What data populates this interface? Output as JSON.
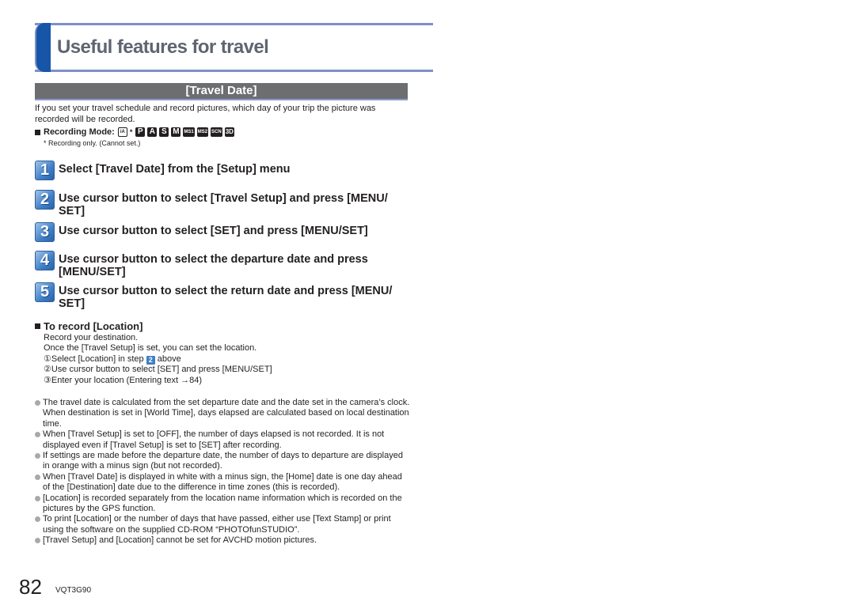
{
  "header": {
    "title": "Useful features for travel"
  },
  "section": {
    "title": "[Travel Date]"
  },
  "intro": "If you set your travel schedule and record pictures, which day of your trip the picture was recorded will be recorded.",
  "recording_mode": {
    "label": "Recording Mode:",
    "icons": [
      {
        "name": "intelligent-auto-mode-icon",
        "glyph": "iA",
        "starred": true
      },
      {
        "name": "program-mode-icon",
        "glyph": "P"
      },
      {
        "name": "aperture-priority-mode-icon",
        "glyph": "A"
      },
      {
        "name": "shutter-priority-mode-icon",
        "glyph": "S"
      },
      {
        "name": "manual-mode-icon",
        "glyph": "M"
      },
      {
        "name": "custom-1-mode-icon",
        "glyph": "MS1"
      },
      {
        "name": "custom-2-mode-icon",
        "glyph": "MS2"
      },
      {
        "name": "scene-mode-icon",
        "glyph": "SCN"
      },
      {
        "name": "3d-mode-icon",
        "glyph": "3D"
      }
    ],
    "star": "*",
    "note": "* Recording only. (Cannot set.)"
  },
  "steps": [
    {
      "number": "1",
      "text": "Select [Travel Date] from the [Setup] menu"
    },
    {
      "number": "2",
      "text": "Use cursor button to select [Travel Setup] and press [MENU/ SET]"
    },
    {
      "number": "3",
      "text": "Use cursor button to select [SET] and press [MENU/SET]"
    },
    {
      "number": "4",
      "text": "Use cursor button to select the departure date and press [MENU/SET]"
    },
    {
      "number": "5",
      "text": "Use cursor button to select the return date and press [MENU/ SET]"
    }
  ],
  "location": {
    "title": "To record [Location]",
    "line1": "Record your destination.",
    "line2": "Once the [Travel Setup] is set, you can set the location.",
    "sub1_prefix": "①Select [Location] in step",
    "sub1_step": "2",
    "sub1_suffix": "above",
    "sub2": "②Use cursor button to select [SET] and press [MENU/SET]",
    "sub3": "③Enter your location (Entering text →84)"
  },
  "notes": [
    "The travel date is calculated from the set departure date and the date set in the camera’s clock. When destination is set in [World Time], days elapsed are calculated based on local destination time.",
    "When [Travel Setup] is set to [OFF], the number of days elapsed is not recorded. It is not displayed even if [Travel Setup] is set to [SET] after recording.",
    "If settings are made before the departure date, the number of days to departure are displayed in orange with a minus sign (but not recorded).",
    "When [Travel Date] is displayed in white with a minus sign, the [Home] date is one day ahead of the [Destination] date due to the difference in time zones (this is recorded).",
    "[Location] is recorded separately from the location name information which is recorded on the pictures by the GPS function.",
    "To print [Location] or the number of days that have passed, either use [Text Stamp] or print using the software on the supplied CD-ROM “PHOTOfunSTUDIO”.",
    "[Travel Setup] and [Location] cannot be set for AVCHD motion pictures."
  ],
  "footer": {
    "page_number": "82",
    "doc_code": "VQT3G90"
  }
}
